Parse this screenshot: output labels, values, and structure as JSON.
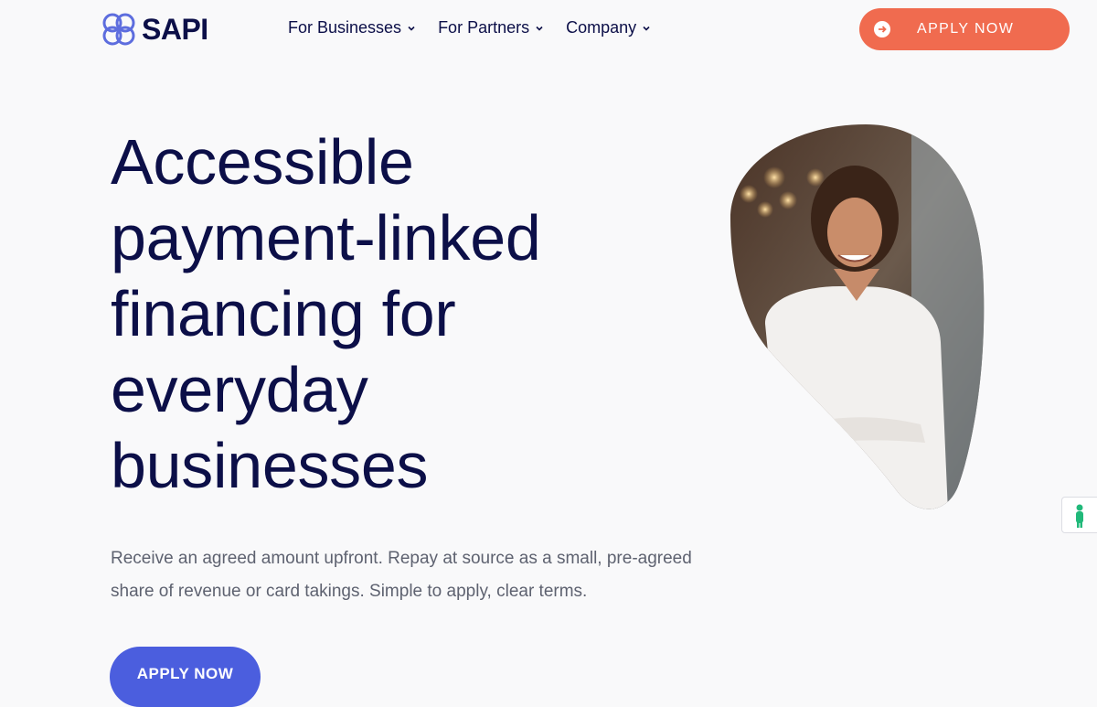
{
  "header": {
    "logo_text": "SAPI",
    "nav": [
      {
        "label": "For Businesses"
      },
      {
        "label": "For Partners"
      },
      {
        "label": "Company"
      }
    ],
    "cta_label": "APPLY NOW"
  },
  "hero": {
    "title_lines": [
      "Accessible",
      "payment-linked",
      "financing for",
      "everyday",
      "businesses"
    ],
    "subtitle": "Receive an agreed amount upfront. Repay at source as a small, pre-agreed share of revenue or card takings. Simple to apply, clear terms.",
    "cta_label": "APPLY NOW"
  },
  "colors": {
    "navy": "#0c0f48",
    "coral": "#f06b4f",
    "blue": "#4b5ede",
    "logo": "#5d6dde",
    "accessibility": "#21b97a"
  },
  "icons": {
    "logo": "clover-logo-icon",
    "nav_chevron": "chevron-down-icon",
    "cta": "arrow-right-circle-icon",
    "accessibility": "accessibility-icon"
  }
}
